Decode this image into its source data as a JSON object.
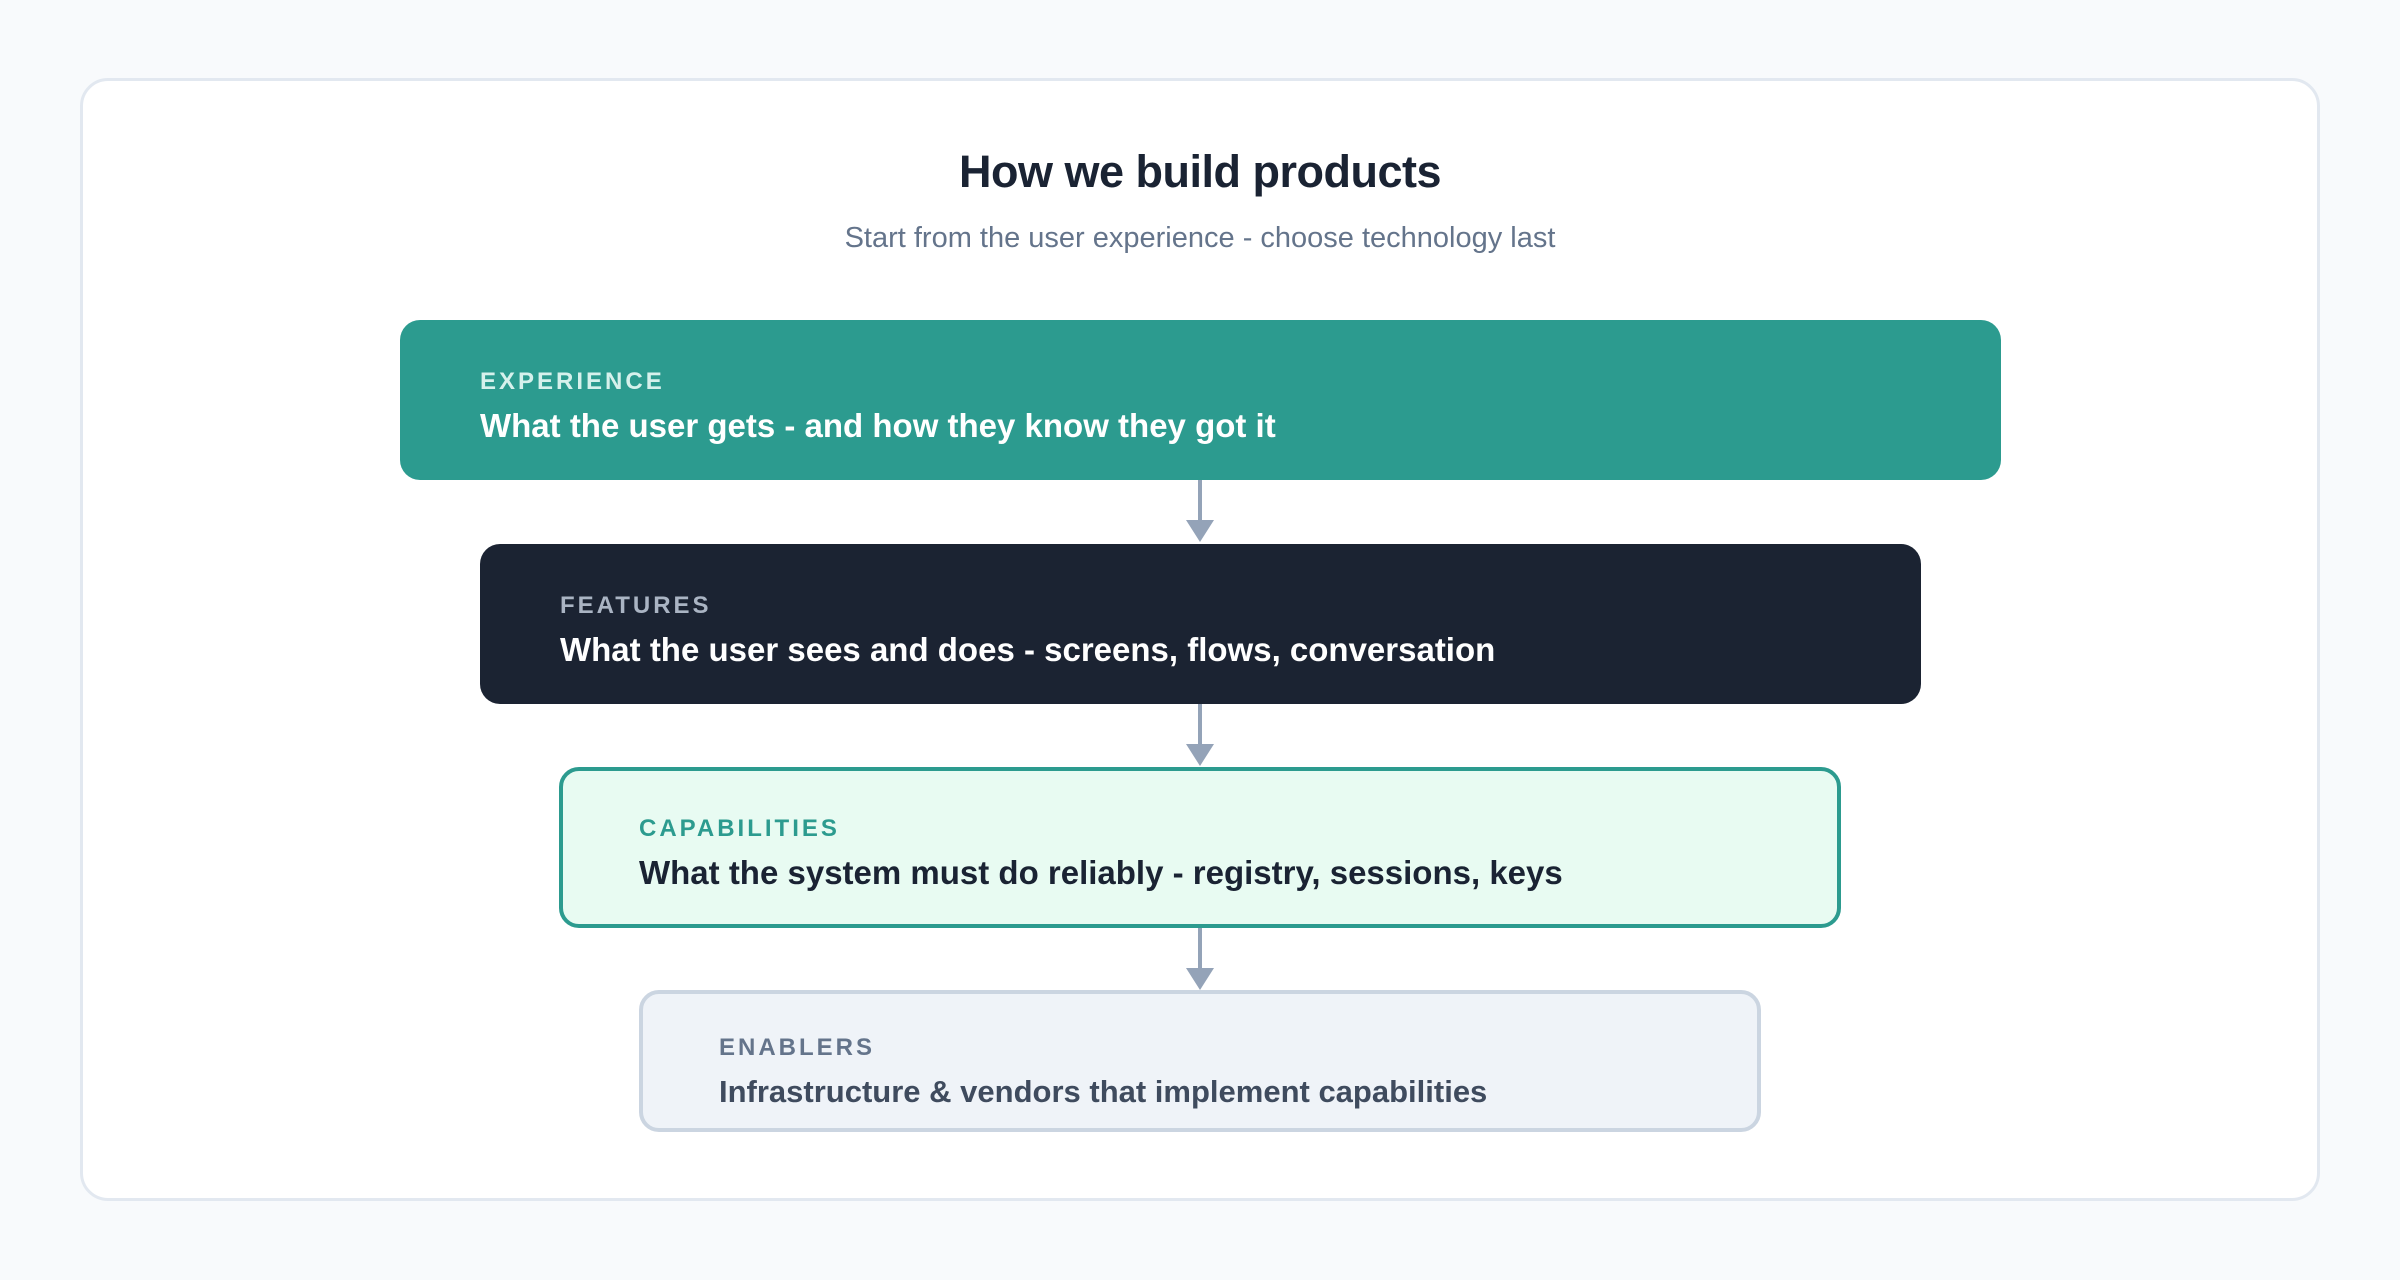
{
  "diagram": {
    "title": "How we build products",
    "subtitle": "Start from the user experience - choose technology last",
    "layers": [
      {
        "label": "EXPERIENCE",
        "description": "What the user gets - and how they know they got it",
        "color": "#2c9b8f"
      },
      {
        "label": "FEATURES",
        "description": "What the user sees and does - screens, flows, conversation",
        "color": "#1b2332"
      },
      {
        "label": "CAPABILITIES",
        "description": "What the system must do reliably - registry, sessions, keys",
        "color": "#e8fbf2"
      },
      {
        "label": "ENABLERS",
        "description": "Infrastructure & vendors that implement capabilities",
        "color": "#eff3f8"
      }
    ],
    "connector_color": "#94a3b8"
  }
}
